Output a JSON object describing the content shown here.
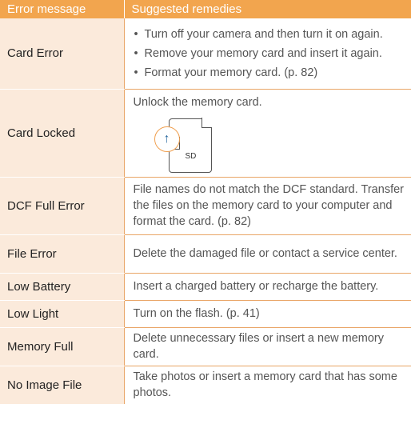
{
  "header": {
    "col1": "Error message",
    "col2": "Suggested remedies"
  },
  "rows": [
    {
      "name": "Card Error",
      "bullets": [
        "Turn off your camera and then turn it on again.",
        "Remove your memory card and insert it again.",
        "Format your memory card. (p. 82)"
      ]
    },
    {
      "name": "Card Locked",
      "text": "Unlock the memory card.",
      "figure": {
        "card_label": "SD",
        "icon": "up-arrow-lock-icon"
      }
    },
    {
      "name": "DCF Full Error",
      "text": "File names do not match the DCF standard. Transfer the files on the memory card to your computer and format the card. (p. 82)"
    },
    {
      "name": "File Error",
      "text": "Delete the damaged file or contact a service center."
    },
    {
      "name": "Low Battery",
      "text": "Insert a charged battery or recharge the battery."
    },
    {
      "name": "Low Light",
      "text": "Turn on the flash. (p. 41)"
    },
    {
      "name": "Memory Full",
      "text": "Delete unnecessary files or insert a new memory card."
    },
    {
      "name": "No Image File",
      "text": "Take photos or insert a memory card that has some photos."
    }
  ],
  "colors": {
    "header": "#f2a54e",
    "label_bg": "#fbeadb",
    "border": "#e9a566"
  }
}
